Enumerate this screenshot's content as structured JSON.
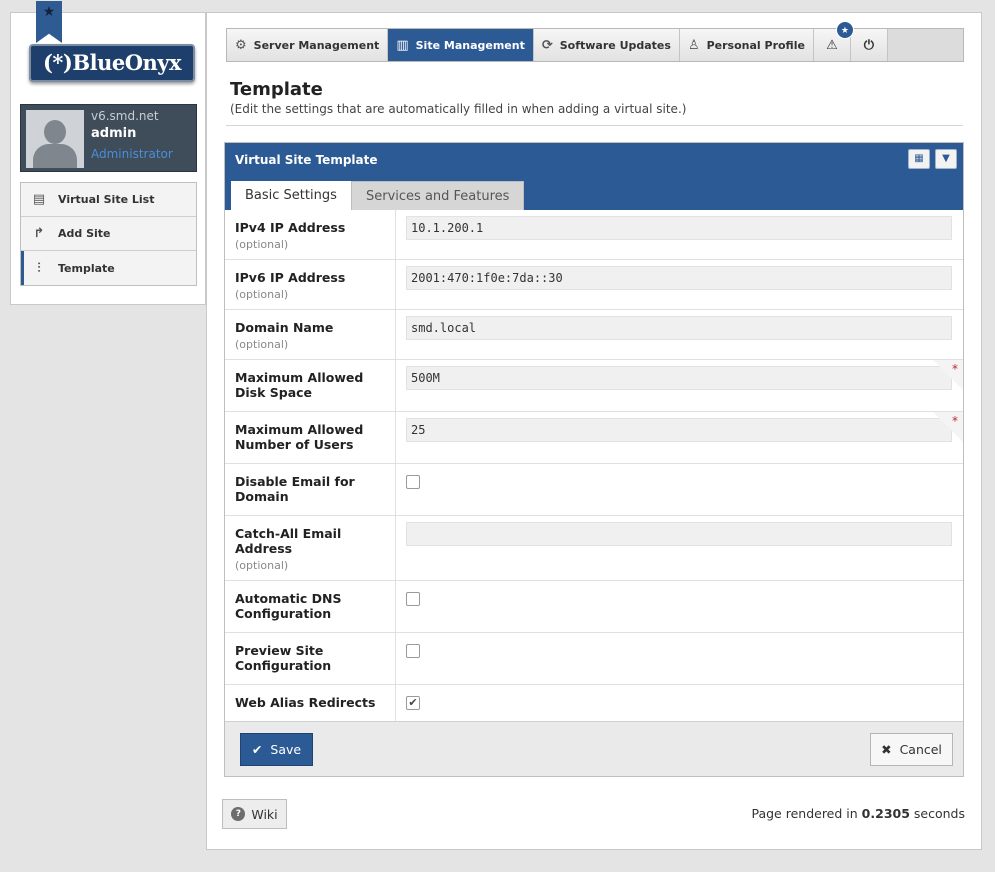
{
  "brand": {
    "logo_text": "(*)BlueOnyx",
    "ribbon_icon": "star-icon"
  },
  "user": {
    "host": "v6.smd.net",
    "name": "admin",
    "role": "Administrator"
  },
  "sidebar": {
    "items": [
      {
        "label": "Virtual Site List",
        "icon": "list-icon"
      },
      {
        "label": "Add Site",
        "icon": "share-arrow-icon"
      },
      {
        "label": "Template",
        "icon": "sliders-icon"
      }
    ]
  },
  "topnav": {
    "items": [
      {
        "label": "Server Management",
        "icon": "gear-icon"
      },
      {
        "label": "Site Management",
        "icon": "layout-icon",
        "active": true
      },
      {
        "label": "Software Updates",
        "icon": "refresh-icon"
      },
      {
        "label": "Personal Profile",
        "icon": "person-icon"
      }
    ],
    "alerts_badge_icon": "star-icon",
    "alerts_icon": "warning-icon",
    "logout_icon": "power-icon"
  },
  "page": {
    "title": "Template",
    "subtitle": "(Edit the settings that are automatically filled in when adding a virtual site.)"
  },
  "panel": {
    "title": "Virtual Site Template",
    "tabs": [
      "Basic Settings",
      "Services and Features"
    ],
    "optional_text": "(optional)",
    "fields": {
      "ipv4": {
        "label": "IPv4 IP Address",
        "value": "10.1.200.1"
      },
      "ipv6": {
        "label": "IPv6 IP Address",
        "value": "2001:470:1f0e:7da::30"
      },
      "domain": {
        "label": "Domain Name",
        "value": "smd.local"
      },
      "disk": {
        "label": "Maximum Allowed Disk Space",
        "value": "500M"
      },
      "users": {
        "label": "Maximum Allowed Number of Users",
        "value": "25"
      },
      "disable_email": {
        "label": "Disable Email for Domain",
        "checked": false
      },
      "catchall": {
        "label": "Catch-All Email Address",
        "value": ""
      },
      "auto_dns": {
        "label": "Automatic DNS Configuration",
        "checked": false
      },
      "preview": {
        "label": "Preview Site Configuration",
        "checked": false
      },
      "web_alias": {
        "label": "Web Alias Redirects",
        "checked": true
      }
    },
    "save_label": "Save",
    "cancel_label": "Cancel",
    "required_marker": "*"
  },
  "footer": {
    "wiki_label": "Wiki",
    "render_prefix": "Page rendered in",
    "render_time": "0.2305",
    "render_suffix": "seconds"
  },
  "colors": {
    "accent": "#2c5a94",
    "required": "#c0282d"
  }
}
